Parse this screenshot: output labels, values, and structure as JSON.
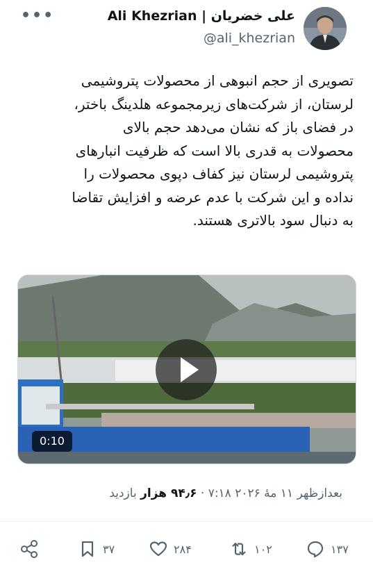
{
  "header": {
    "name_en": "Ali Khezrian",
    "separator": "|",
    "name_fa": "علی خضریان",
    "handle": "@ali_khezrian",
    "more": "•••"
  },
  "tweet": {
    "text": "تصویری از حجم انبوهی از محصولات پتروشیمی\nلرستان، از شرکت‌های زیرمجموعه هلدینگ باختر،\nدر فضای باز که نشان می‌دهد حجم بالای\nمحصولات به قدری بالا است که ظرفیت انبارهای\nپتروشیمی لرستان نیز کفاف دپوی محصولات را\nنداده و این شرکت با عدم عرضه و افزایش تقاضا\nبه دنبال سود بالاتری هستند."
  },
  "media": {
    "duration": "0:10"
  },
  "meta": {
    "time_date": "بعدازظهر ۱۱ مهٔ ۲۰۲۶ ۷:۱۸",
    "dot": " · ",
    "views_count": "۹۴٫۶ هزار",
    "views_label": " بازدید"
  },
  "actions": {
    "replies": "۱۳۷",
    "retweets": "۱۰۲",
    "likes": "۲۸۴",
    "bookmarks": "۳۷"
  }
}
